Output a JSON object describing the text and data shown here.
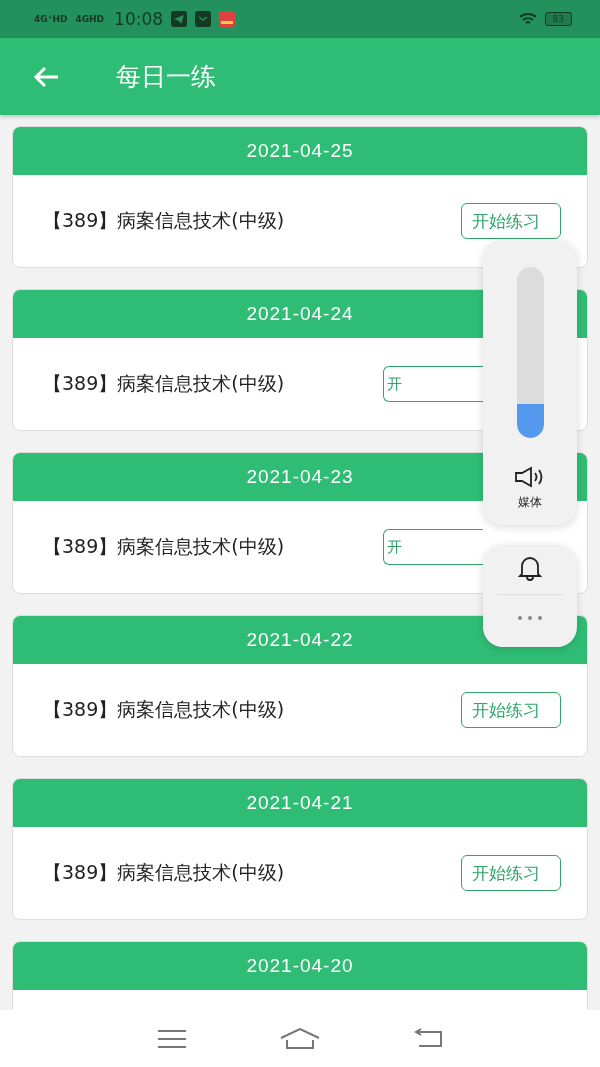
{
  "status_bar": {
    "networks": [
      "4G⁺HD",
      "4GHD"
    ],
    "time": "10:08",
    "battery": "83"
  },
  "app_bar": {
    "title": "每日一练"
  },
  "cards": [
    {
      "date": "2021-04-25",
      "title": "【389】病案信息技术(中级)",
      "button": "开始练习",
      "kind": "full"
    },
    {
      "date": "2021-04-24",
      "title": "【389】病案信息技术(中级)",
      "button": "开",
      "kind": "covered"
    },
    {
      "date": "2021-04-23",
      "title": "【389】病案信息技术(中级)",
      "button": "开",
      "kind": "covered"
    },
    {
      "date": "2021-04-22",
      "title": "【389】病案信息技术(中级)",
      "button": "开始练习",
      "kind": "full"
    },
    {
      "date": "2021-04-21",
      "title": "【389】病案信息技术(中级)",
      "button": "开始练习",
      "kind": "full"
    },
    {
      "date": "2021-04-20"
    }
  ],
  "volume_panel": {
    "level": 0.2,
    "label": "媒体"
  }
}
